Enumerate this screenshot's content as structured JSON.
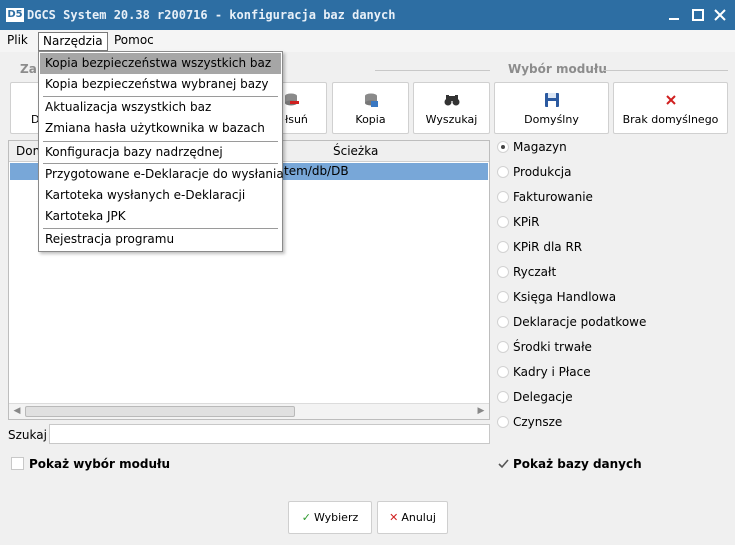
{
  "titlebar": {
    "logo": "D5",
    "title": "DGCS System 20.38 r200716 - konfiguracja baz danych"
  },
  "menubar": {
    "items": [
      "Plik",
      "Narzędzia",
      "Pomoc"
    ]
  },
  "dropdown": {
    "items": [
      "Kopia bezpieczeństwa wszystkich baz",
      "Kopia bezpieczeństwa wybranej bazy",
      "Aktualizacja wszystkich baz",
      "Zmiana hasła użytkownika w bazach",
      "Konfiguracja bazy nadrzędnej",
      "Przygotowane e-Deklaracje do wysłania",
      "Kartoteka wysłanych e-Deklaracji",
      "Kartoteka JPK",
      "Rejestracja programu"
    ]
  },
  "left_group": {
    "title_visible": "Za",
    "buttons": {
      "partial_first": "D",
      "partial_remove": "łsuń",
      "copy": "Kopia",
      "search": "Wyszukaj"
    }
  },
  "module_group": {
    "title": "Wybór modułu",
    "default_button": "Domyślny",
    "no_default_button": "Brak domyślnego",
    "modules": [
      "Magazyn",
      "Produkcja",
      "Fakturowanie",
      "KPiR",
      "KPiR dla RR",
      "Ryczałt",
      "Księga Handlowa",
      "Deklaracje podatkowe",
      "Środki trwałe",
      "Kadry i Płace",
      "Delegacje",
      "Czynsze"
    ],
    "selected": "Magazyn"
  },
  "table": {
    "columns": [
      "Dom",
      "Ścieżka"
    ],
    "rows": [
      {
        "path_visible": "tem/db/DB"
      }
    ]
  },
  "search": {
    "label": "Szukaj",
    "value": ""
  },
  "checkboxes": {
    "show_module": "Pokaż wybór modułu",
    "show_module_checked": false,
    "show_databases": "Pokaż bazy danych",
    "show_databases_checked": true
  },
  "dialog_buttons": {
    "ok": "Wybierz",
    "cancel": "Anuluj"
  },
  "colors": {
    "titlebar": "#2d6ea3",
    "selected_row": "#78a7d8",
    "menu_highlight": "#a6a6a6",
    "ok_mark": "#2e9a2e",
    "cancel_mark": "#d02020"
  }
}
